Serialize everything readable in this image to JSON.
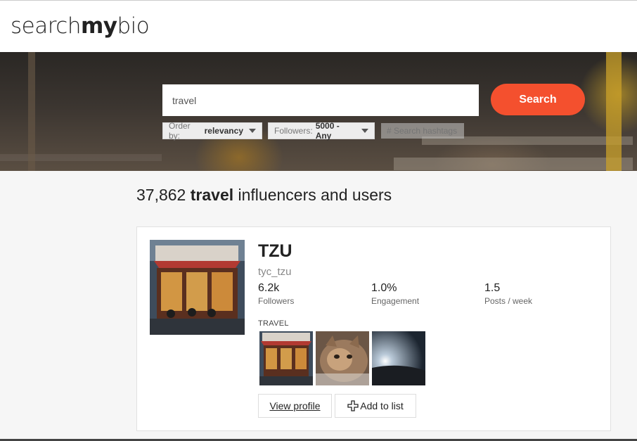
{
  "brand": {
    "logo_light_1": "search",
    "logo_bold": "my",
    "logo_light_2": "bio"
  },
  "search": {
    "value": "travel",
    "button_label": "Search",
    "hashtag_placeholder": "# Search hashtags"
  },
  "filters": {
    "order_label": "Order by:",
    "order_value": "relevancy",
    "followers_label": "Followers:",
    "followers_value": "5000 - Any"
  },
  "results": {
    "count": "37,862",
    "keyword": "travel",
    "suffix": "influencers and users"
  },
  "profile": {
    "name": "TZU",
    "handle": "tyc_tzu",
    "stats": [
      {
        "value": "6.2k",
        "label": "Followers"
      },
      {
        "value": "1.0%",
        "label": "Engagement"
      },
      {
        "value": "1.5",
        "label": "Posts / week"
      }
    ],
    "category": "TRAVEL",
    "view_label": "View profile",
    "add_label": "Add to list"
  },
  "icons": {
    "caret": "chevron-down-icon",
    "add": "plus-icon"
  },
  "colors": {
    "accent": "#f4502e"
  }
}
